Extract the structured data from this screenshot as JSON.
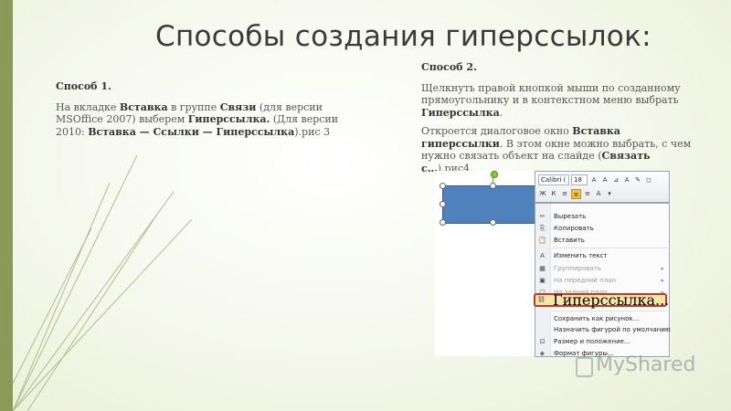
{
  "slide": {
    "title": "Способы создания гиперссылок:",
    "colors": {
      "accent_bar": "#8c9a57",
      "shape_fill": "#4f81bd",
      "highlight_border": "#c0392b"
    }
  },
  "method1": {
    "heading": "Способ 1.",
    "parts": [
      {
        "t": "На вкладке ",
        "b": false
      },
      {
        "t": "Вставка",
        "b": true
      },
      {
        "t": " в группе ",
        "b": false
      },
      {
        "t": "Связи",
        "b": true
      },
      {
        "t": " (для версии MSOffice 2007) выберем ",
        "b": false
      },
      {
        "t": "Гиперссылка.",
        "b": true
      },
      {
        "t": " (Для версии 2010: ",
        "b": false
      },
      {
        "t": "Вставка — Ссылки — Гиперссылка",
        "b": true
      },
      {
        "t": ").рис 3",
        "b": false
      }
    ]
  },
  "method2": {
    "heading": "Способ 2.",
    "para1_parts": [
      {
        "t": "Щелкнуть правой кнопкой мыши по созданному прямоугольнику и в контекстном меню выбрать ",
        "b": false
      },
      {
        "t": "Гиперссылка",
        "b": true
      },
      {
        "t": ".",
        "b": false
      }
    ],
    "para2_parts": [
      {
        "t": "Откроется диалоговое окно ",
        "b": false
      },
      {
        "t": "Вставка гиперссылки",
        "b": true
      },
      {
        "t": ". В этом окне можно выбрать, с чем нужно связать объект на слайде (",
        "b": false
      },
      {
        "t": "Связать с…",
        "b": true
      },
      {
        "t": ").рис4",
        "b": false
      }
    ]
  },
  "toolbar": {
    "font": "Calibri (",
    "size": "18",
    "row1_buttons": [
      "A",
      "A",
      "⊿",
      "A",
      "✎",
      "◻"
    ],
    "row2_buttons": [
      "Ж",
      "К",
      "≡",
      "≡",
      "≡",
      "A",
      "▾"
    ]
  },
  "context_menu": {
    "items": [
      {
        "label": "Вырезать",
        "icon": "scissors-icon",
        "glyph": "✂",
        "disabled": false,
        "submenu": false
      },
      {
        "label": "Копировать",
        "icon": "copy-icon",
        "glyph": "⎘",
        "disabled": false,
        "submenu": false
      },
      {
        "label": "Вставить",
        "icon": "paste-icon",
        "glyph": "📋",
        "disabled": false,
        "submenu": false
      },
      {
        "label": "Изменить текст",
        "icon": "edit-text-icon",
        "glyph": "A",
        "disabled": false,
        "submenu": false
      },
      {
        "label": "Группировать",
        "icon": "group-icon",
        "glyph": "▦",
        "disabled": true,
        "submenu": true
      },
      {
        "label": "На передний план",
        "icon": "bring-front-icon",
        "glyph": "▣",
        "disabled": true,
        "submenu": true
      },
      {
        "label": "На задний план",
        "icon": "send-back-icon",
        "glyph": "▢",
        "disabled": true,
        "submenu": true
      },
      {
        "label": "Гиперссылка...",
        "icon": "hyperlink-icon",
        "glyph": "🔗",
        "disabled": false,
        "submenu": false
      },
      {
        "label": "Сохранить как рисунок...",
        "icon": "save-picture-icon",
        "glyph": "",
        "disabled": false,
        "submenu": false
      },
      {
        "label": "Назначить фигурой по умолчанию",
        "icon": "default-shape-icon",
        "glyph": "",
        "disabled": false,
        "submenu": false
      },
      {
        "label": "Размер и положение...",
        "icon": "size-position-icon",
        "glyph": "⊡",
        "disabled": false,
        "submenu": false
      },
      {
        "label": "Формат фигуры...",
        "icon": "format-shape-icon",
        "glyph": "◈",
        "disabled": false,
        "submenu": false
      }
    ]
  },
  "watermark": {
    "text": "MyShared"
  }
}
